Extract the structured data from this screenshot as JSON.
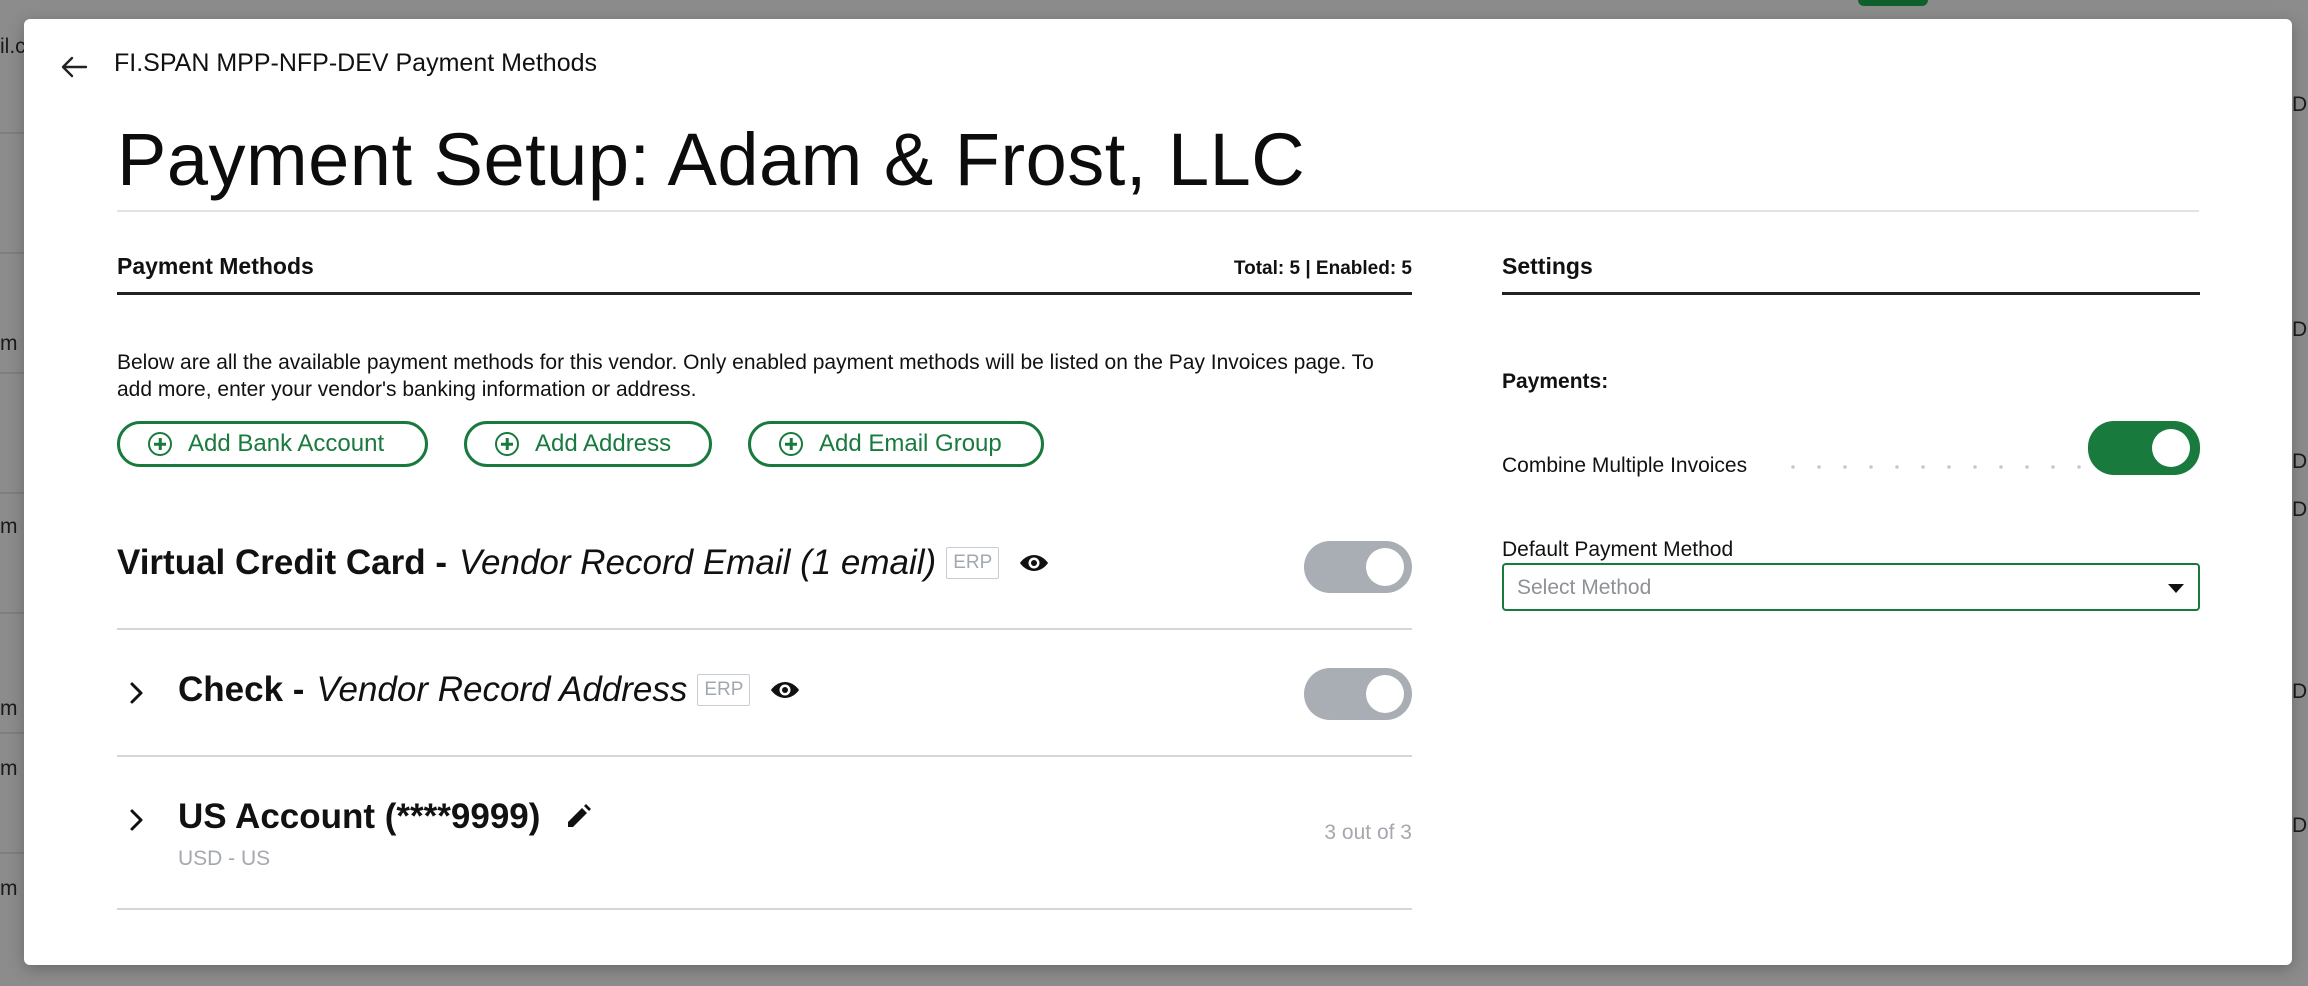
{
  "background": {
    "left_fragments": [
      "il.c",
      "m",
      "m",
      "m",
      "m",
      "m"
    ],
    "right_fragments": [
      "Da",
      "Da",
      "Da",
      "Da",
      "Da",
      "Da"
    ]
  },
  "modal": {
    "title": "FI.SPAN MPP-NFP-DEV Payment Methods",
    "page_title": "Payment Setup: Adam & Frost, LLC"
  },
  "payment_methods": {
    "header": "Payment Methods",
    "totals": "Total: 5 | Enabled: 5",
    "description": "Below are all the available payment methods for this vendor. Only enabled payment methods will be listed on the Pay Invoices page. To add more, enter your vendor's banking information or address.",
    "buttons": {
      "add_bank_account": "Add Bank Account",
      "add_address": "Add Address",
      "add_email_group": "Add Email Group"
    },
    "methods": [
      {
        "name": "Virtual Credit Card -",
        "detail": "Vendor Record Email (1 email)",
        "badge": "ERP",
        "enabled": true
      },
      {
        "name": "Check -",
        "detail": "Vendor Record Address",
        "badge": "ERP",
        "enabled": true
      },
      {
        "name": "US Account (****9999)",
        "sub": "USD - US",
        "count": "3 out of 3"
      }
    ]
  },
  "settings": {
    "header": "Settings",
    "payments_label": "Payments:",
    "combine_label": "Combine Multiple Invoices",
    "combine_enabled": true,
    "default_label": "Default Payment Method",
    "select_placeholder": "Select Method"
  },
  "colors": {
    "accent": "#197a3e",
    "toggle_off": "#a9adb4",
    "muted_text": "#a5a8ae"
  }
}
